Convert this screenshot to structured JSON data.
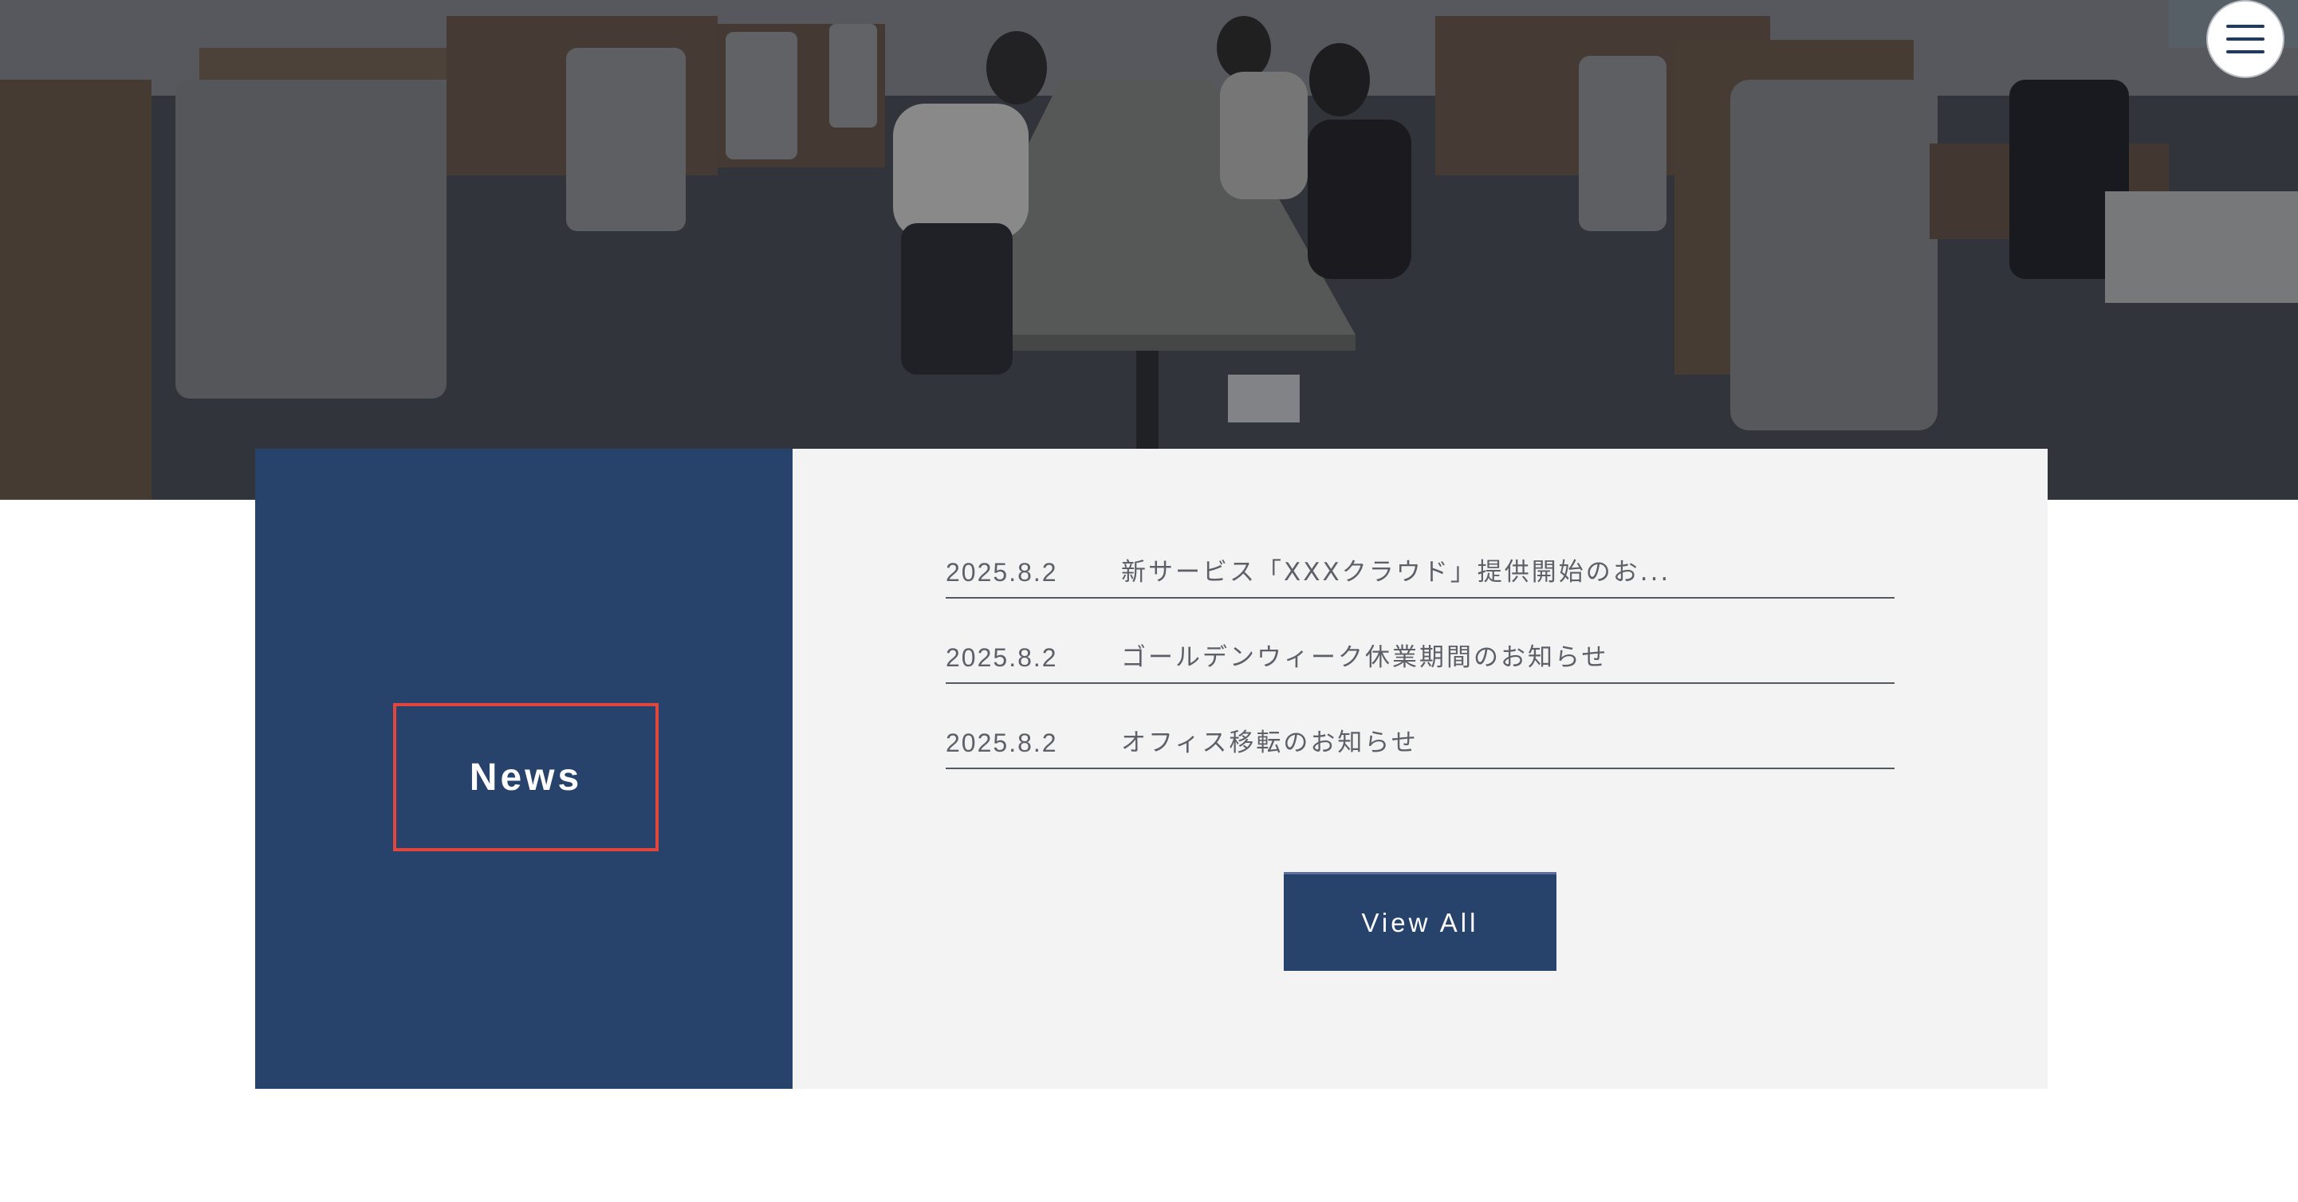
{
  "header": {
    "menu_icon": "hamburger-menu-icon"
  },
  "hero": {
    "image": "office-photo"
  },
  "news": {
    "title": "News",
    "items": [
      {
        "date": "2025.8.2",
        "text": "新サービス「XXXクラウド」提供開始のお..."
      },
      {
        "date": "2025.8.2",
        "text": "ゴールデンウィーク休業期間のお知らせ"
      },
      {
        "date": "2025.8.2",
        "text": "オフィス移転のお知らせ"
      }
    ],
    "view_all_label": "View All"
  },
  "colors": {
    "navy": "#27426b",
    "accent_red": "#e0463b",
    "panel_gray": "#f3f3f3",
    "text_gray": "#5d6068"
  }
}
